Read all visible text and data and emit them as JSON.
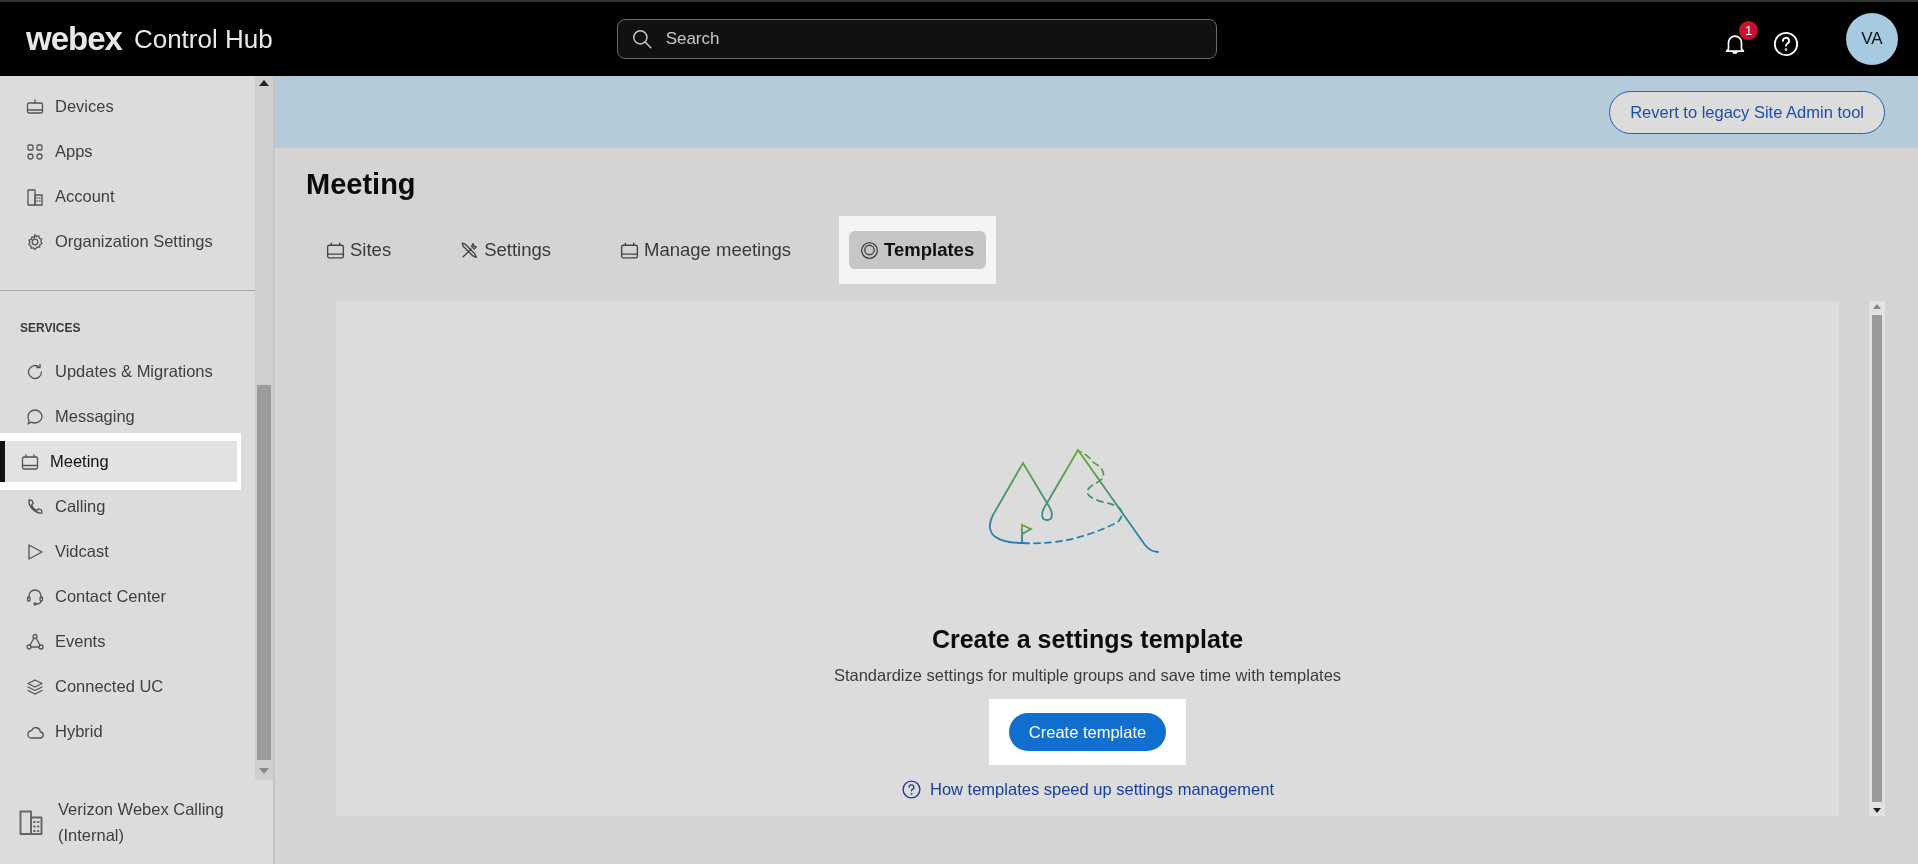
{
  "header": {
    "logo": "webex",
    "product": "Control Hub",
    "search": {
      "placeholder": "Search"
    },
    "notifications": {
      "count": "1"
    },
    "avatar": {
      "initials": "VA"
    }
  },
  "sidebar": {
    "items": [
      {
        "label": "Devices",
        "selected": false,
        "highlighted": false
      },
      {
        "label": "Apps",
        "selected": false,
        "highlighted": false
      },
      {
        "label": "Account",
        "selected": false,
        "highlighted": false
      },
      {
        "label": "Organization Settings",
        "selected": false,
        "highlighted": false
      }
    ],
    "section_heading": "SERVICES",
    "services": [
      {
        "label": "Updates & Migrations",
        "selected": false,
        "highlighted": false
      },
      {
        "label": "Messaging",
        "selected": false,
        "highlighted": false
      },
      {
        "label": "Meeting",
        "selected": true,
        "highlighted": true
      },
      {
        "label": "Calling",
        "selected": false,
        "highlighted": false
      },
      {
        "label": "Vidcast",
        "selected": false,
        "highlighted": false
      },
      {
        "label": "Contact Center",
        "selected": false,
        "highlighted": false
      },
      {
        "label": "Events",
        "selected": false,
        "highlighted": false
      },
      {
        "label": "Connected UC",
        "selected": false,
        "highlighted": false
      },
      {
        "label": "Hybrid",
        "selected": false,
        "highlighted": false
      }
    ],
    "org": {
      "name": "Verizon Webex Calling (Internal)"
    }
  },
  "banner": {
    "button": "Revert to legacy Site Admin tool"
  },
  "page": {
    "title": "Meeting",
    "tabs": [
      {
        "label": "Sites",
        "selected": false,
        "highlighted": false
      },
      {
        "label": "Settings",
        "selected": false,
        "highlighted": false
      },
      {
        "label": "Manage meetings",
        "selected": false,
        "highlighted": false
      },
      {
        "label": "Templates",
        "selected": true,
        "highlighted": true
      }
    ],
    "empty_state": {
      "heading": "Create a settings template",
      "description": "Standardize settings for multiple groups and save time with templates",
      "button": {
        "label": "Create template",
        "highlighted": true
      },
      "help_link": "How templates speed up settings management"
    }
  }
}
